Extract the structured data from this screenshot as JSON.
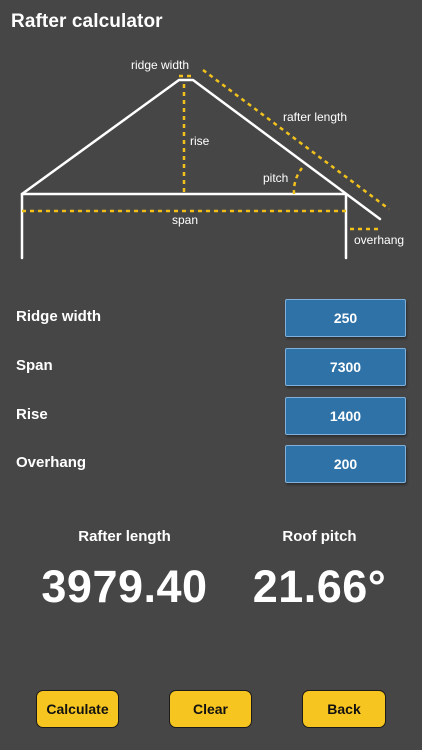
{
  "app": {
    "title": "Rafter calculator"
  },
  "diagram": {
    "labels": {
      "ridge_width": "ridge width",
      "rafter_length": "rafter length",
      "rise": "rise",
      "pitch": "pitch",
      "span": "span",
      "overhang": "overhang"
    },
    "colors": {
      "structure": "#ffffff",
      "dimension": "#f2c21c"
    }
  },
  "fields": [
    {
      "label": "Ridge width",
      "value": "250"
    },
    {
      "label": "Span",
      "value": "7300"
    },
    {
      "label": "Rise",
      "value": "1400"
    },
    {
      "label": "Overhang",
      "value": "200"
    }
  ],
  "results": {
    "rafter_length": {
      "label": "Rafter length",
      "value": "3979.40"
    },
    "roof_pitch": {
      "label": "Roof pitch",
      "value": "21.66°"
    }
  },
  "buttons": {
    "calculate": "Calculate",
    "clear": "Clear",
    "back": "Back"
  },
  "colors": {
    "background": "#464646",
    "input_fill": "#2e72a8",
    "input_border": "#7fb1dc",
    "button_fill": "#f7c520"
  }
}
